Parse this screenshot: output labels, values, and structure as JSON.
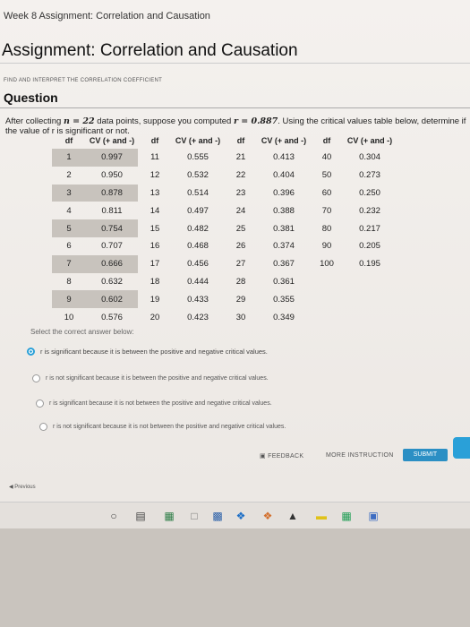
{
  "breadcrumb": "Week 8 Assignment: Correlation and Causation",
  "title": "Assignment: Correlation and Causation",
  "subtitle": "Find and interpret the correlation coefficient",
  "question_head": "Question",
  "prompt": {
    "before_n": "After collecting ",
    "n_expr": "n = 22",
    "mid": " data points, suppose you computed ",
    "r_expr": "r = 0.887",
    "after": ". Using the critical values table below, determine if the value of r is significant or not."
  },
  "table": {
    "headers": [
      "df",
      "CV (+ and -)",
      "df",
      "CV (+ and -)",
      "df",
      "CV (+ and -)",
      "df",
      "CV (+ and -)"
    ],
    "rows": [
      [
        "1",
        "0.997",
        "11",
        "0.555",
        "21",
        "0.413",
        "40",
        "0.304"
      ],
      [
        "2",
        "0.950",
        "12",
        "0.532",
        "22",
        "0.404",
        "50",
        "0.273"
      ],
      [
        "3",
        "0.878",
        "13",
        "0.514",
        "23",
        "0.396",
        "60",
        "0.250"
      ],
      [
        "4",
        "0.811",
        "14",
        "0.497",
        "24",
        "0.388",
        "70",
        "0.232"
      ],
      [
        "5",
        "0.754",
        "15",
        "0.482",
        "25",
        "0.381",
        "80",
        "0.217"
      ],
      [
        "6",
        "0.707",
        "16",
        "0.468",
        "26",
        "0.374",
        "90",
        "0.205"
      ],
      [
        "7",
        "0.666",
        "17",
        "0.456",
        "27",
        "0.367",
        "100",
        "0.195"
      ],
      [
        "8",
        "0.632",
        "18",
        "0.444",
        "28",
        "0.361",
        "",
        ""
      ],
      [
        "9",
        "0.602",
        "19",
        "0.433",
        "29",
        "0.355",
        "",
        ""
      ],
      [
        "10",
        "0.576",
        "20",
        "0.423",
        "30",
        "0.349",
        "",
        ""
      ]
    ]
  },
  "select_label": "Select the correct answer below:",
  "options": [
    {
      "label": "r is significant because it is between the positive and negative critical values.",
      "selected": true
    },
    {
      "label": "r is not significant because it is between the positive and negative critical values.",
      "selected": false
    },
    {
      "label": "r is significant because it is not between the positive and negative critical values.",
      "selected": false
    },
    {
      "label": "r is not significant because it is not between the positive and negative critical values.",
      "selected": false
    }
  ],
  "buttons": {
    "feedback": "FEEDBACK",
    "more_instruction": "MORE INSTRUCTION",
    "submit": "SUBMIT"
  },
  "previous": "Previous",
  "colors": {
    "accent": "#2aa0d8",
    "submit": "#2b8fc4"
  }
}
